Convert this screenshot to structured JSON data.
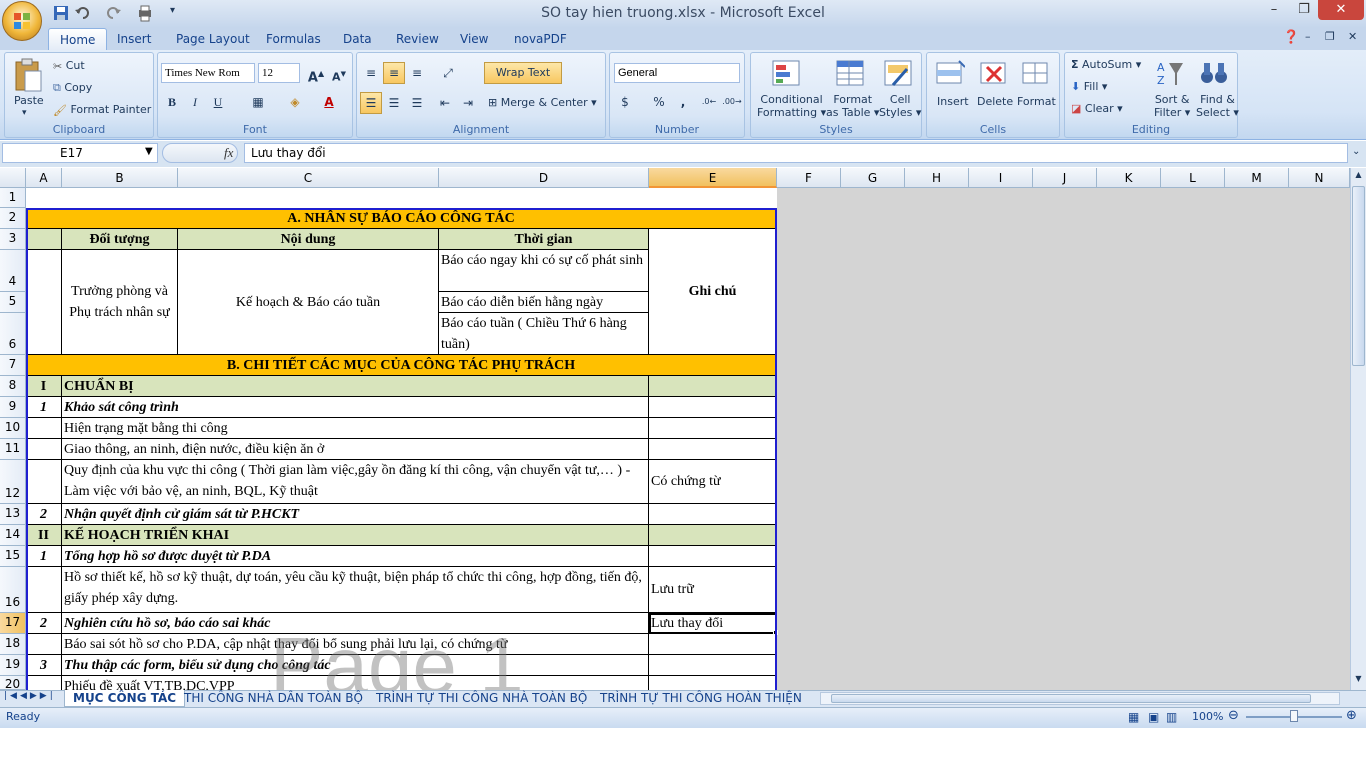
{
  "window": {
    "title": "SO tay hien truong.xlsx - Microsoft Excel",
    "minimize": "–",
    "restore": "❐",
    "close": "✕"
  },
  "tabs": [
    "Home",
    "Insert",
    "Page Layout",
    "Formulas",
    "Data",
    "Review",
    "View",
    "novaPDF"
  ],
  "ribbon": {
    "clipboard": {
      "label": "Clipboard",
      "paste": "Paste",
      "cut": "Cut",
      "copy": "Copy",
      "format_painter": "Format Painter"
    },
    "font": {
      "label": "Font",
      "font_name": "Times New Rom",
      "font_size": "12",
      "bold": "B",
      "italic": "I",
      "underline": "U"
    },
    "alignment": {
      "label": "Alignment",
      "wrap_text": "Wrap Text",
      "merge_center": "Merge & Center"
    },
    "number": {
      "label": "Number",
      "format": "General",
      "currency": "$",
      "percent": "%",
      "comma": ","
    },
    "styles": {
      "label": "Styles",
      "conditional": "Conditional",
      "conditional2": "Formatting",
      "format_as": "Format",
      "format_as2": "as Table",
      "cell": "Cell",
      "cell2": "Styles"
    },
    "cells": {
      "label": "Cells",
      "insert": "Insert",
      "delete": "Delete",
      "format": "Format"
    },
    "editing": {
      "label": "Editing",
      "autosum": "AutoSum",
      "fill": "Fill",
      "clear": "Clear",
      "sort": "Sort &",
      "sort2": "Filter",
      "find": "Find &",
      "find2": "Select"
    }
  },
  "formula_bar": {
    "name_box": "E17",
    "fx": "fx",
    "value": "Lưu thay đổi"
  },
  "columns": [
    "A",
    "B",
    "C",
    "D",
    "E",
    "F",
    "G",
    "H",
    "I",
    "J",
    "K",
    "L",
    "M",
    "N"
  ],
  "rows": [
    "1",
    "2",
    "3",
    "4",
    "5",
    "6",
    "7",
    "8",
    "9",
    "10",
    "11",
    "12",
    "13",
    "14",
    "15",
    "16",
    "17",
    "18",
    "19",
    "20"
  ],
  "sheet": {
    "section_a": "A. NHÂN SỰ BÁO CÁO CÔNG TÁC",
    "hdr_doi_tuong": "Đối tượng",
    "hdr_noi_dung": "Nội dung",
    "hdr_thoi_gian": "Thời gian",
    "hdr_ghi_chu": "Ghi chú",
    "b_truong_phong": "Trưởng phòng và Phụ trách nhân sự",
    "c_ke_hoach": "Kế hoạch & Báo cáo tuần",
    "d4": "Báo cáo ngay khi có sự cố phát sinh",
    "d5": "Báo cáo diễn biến hằng ngày",
    "d6": "Báo cáo tuần ( Chiều Thứ 6 hàng tuần)",
    "section_b": "B. CHI TIẾT CÁC MỤC CỦA CÔNG TÁC PHỤ TRÁCH",
    "a8": "I",
    "b8": "CHUẨN BỊ",
    "a9": "1",
    "b9": "Khảo sát công trình",
    "b10": "Hiện trạng mặt bằng thi công",
    "b11": "Giao thông, an ninh, điện nước, điều kiện ăn ở",
    "b12": "Quy định của khu vực thi công ( Thời gian làm việc,gây ồn đăng kí thi công, vận chuyển vật tư,… ) - Làm việc với bảo vệ, an ninh, BQL, Kỹ thuật",
    "e12": "Có chứng từ",
    "a13": "2",
    "b13": "Nhận quyết định cử giám sát từ P.HCKT",
    "a14": "II",
    "b14": "KẾ HOẠCH TRIỂN KHAI",
    "a15": "1",
    "b15": "Tổng hợp hồ sơ được duyệt từ P.DA",
    "b16": "Hồ sơ thiết kế, hồ sơ kỹ thuật, dự toán, yêu cầu kỹ thuật, biện pháp tổ chức thi công, hợp đồng, tiến độ, giấy phép xây dựng.",
    "e16": "Lưu trữ",
    "a17": "2",
    "b17": "Nghiên cứu hồ sơ, báo cáo sai khác",
    "e17": "Lưu thay đổi",
    "b18": "Báo sai sót hồ sơ cho P.DA, cập nhật thay đổi bổ sung phải lưu lại, có chứng từ",
    "a19": "3",
    "b19": "Thu thập các form, biểu sử dụng cho công tác",
    "b20": "Phiếu đề xuất VT,TB,DC,VPP"
  },
  "watermark": "Page 1",
  "sheet_tabs": [
    "MỤC CÔNG TÁC",
    "THI CÔNG NHÀ DÂN TOÀN BỘ",
    "TRÌNH TỰ THI CÔNG NHÀ TOÀN BỘ",
    "TRÌNH TỰ THI CÔNG HOÀN THIỆN"
  ],
  "status": {
    "ready": "Ready",
    "zoom": "100%"
  },
  "colors": {
    "section_fill": "#ffc000",
    "header_fill": "#d8e4bc",
    "selection": "#f29536"
  }
}
